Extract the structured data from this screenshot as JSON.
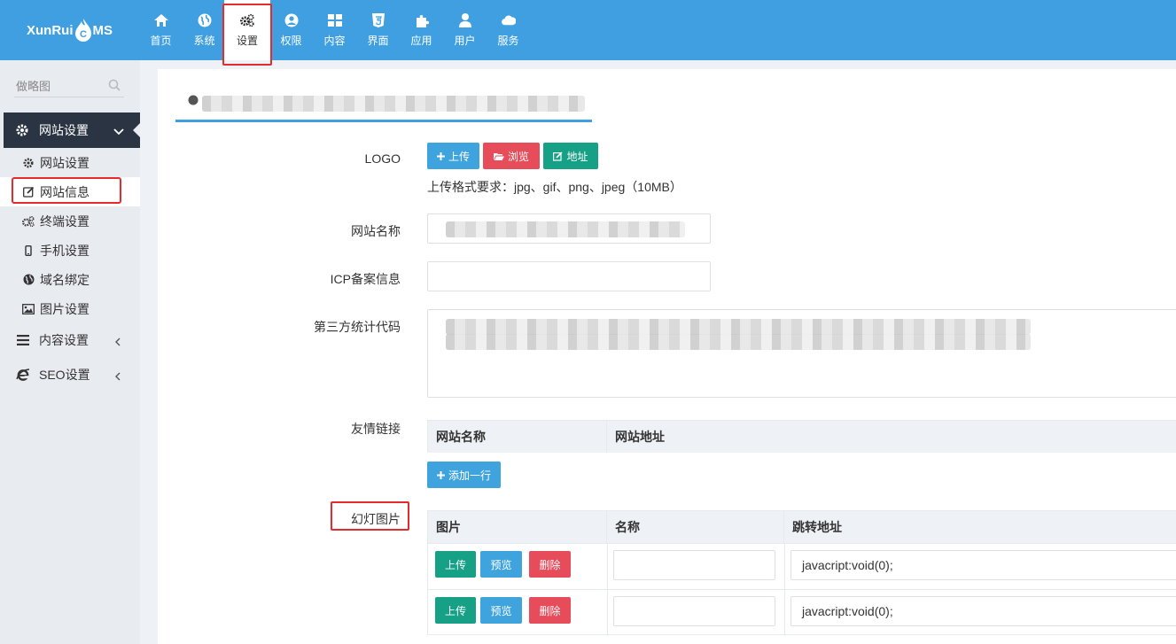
{
  "app": {
    "brand_left": "XunRui",
    "brand_right": "MS"
  },
  "topnav": [
    {
      "label": "首页",
      "icon": "home-icon"
    },
    {
      "label": "系统",
      "icon": "globe-icon"
    },
    {
      "label": "设置",
      "icon": "cogs-icon",
      "active": true
    },
    {
      "label": "权限",
      "icon": "user-circle-icon"
    },
    {
      "label": "内容",
      "icon": "grid-icon"
    },
    {
      "label": "界面",
      "icon": "html5-icon"
    },
    {
      "label": "应用",
      "icon": "puzzle-icon"
    },
    {
      "label": "用户",
      "icon": "user-icon"
    },
    {
      "label": "服务",
      "icon": "cloud-icon"
    }
  ],
  "sidebar": {
    "search_placeholder": "做略图",
    "group": {
      "label": "网站设置"
    },
    "items": [
      {
        "label": "网站设置",
        "icon": "gear-icon"
      },
      {
        "label": "网站信息",
        "icon": "edit-icon",
        "active": true
      },
      {
        "label": "终端设置",
        "icon": "cogs-icon"
      },
      {
        "label": "手机设置",
        "icon": "mobile-icon"
      },
      {
        "label": "域名绑定",
        "icon": "globe-icon"
      },
      {
        "label": "图片设置",
        "icon": "image-icon"
      }
    ],
    "categories": [
      {
        "label": "内容设置",
        "icon": "menu-icon"
      },
      {
        "label": "SEO设置",
        "icon": "ie-icon"
      }
    ]
  },
  "form": {
    "logo_label": "LOGO",
    "upload_btn": "上传",
    "browse_btn": "浏览",
    "address_btn": "地址",
    "upload_hint": "上传格式要求：jpg、gif、png、jpeg（10MB）",
    "site_name_label": "网站名称",
    "icp_label": "ICP备案信息",
    "stats_label": "第三方统计代码",
    "links_label": "友情链接",
    "links_table": {
      "headers": [
        "网站名称",
        "网站地址"
      ]
    },
    "add_row_btn": "添加一行",
    "slides_label": "幻灯图片",
    "slides_table": {
      "headers": [
        "图片",
        "名称",
        "跳转地址"
      ],
      "rows": [
        {
          "upload": "上传",
          "preview": "预览",
          "delete": "删除",
          "name": "",
          "url": "javacript:void(0);"
        },
        {
          "upload": "上传",
          "preview": "预览",
          "delete": "删除",
          "name": "",
          "url": "javacript:void(0);"
        }
      ]
    }
  },
  "colors": {
    "primary": "#3f9fe0",
    "sidebar_dark": "#2a3442",
    "danger": "#e74c5b",
    "teal": "#16a085",
    "highlight": "#e52b2b"
  }
}
